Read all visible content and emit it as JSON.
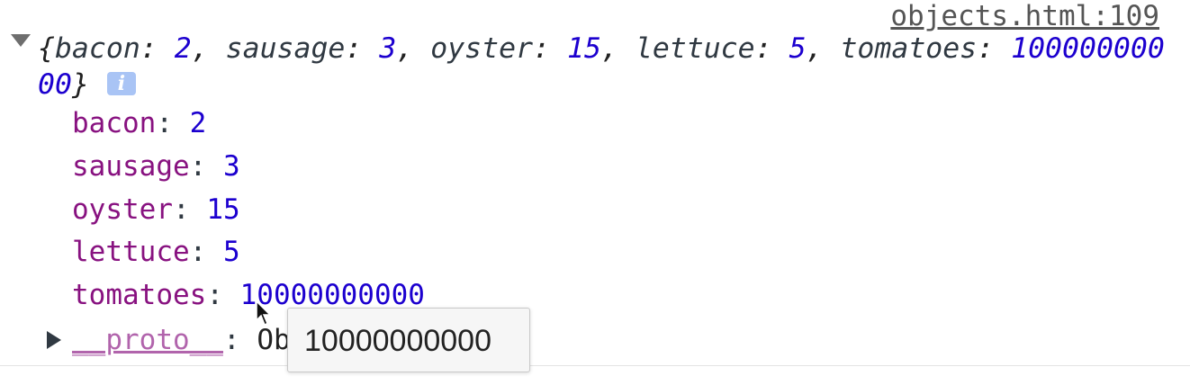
{
  "console": {
    "source_link": "objects.html:109",
    "summary": {
      "open_brace": "{",
      "close_brace": "}",
      "entries": [
        {
          "key": "bacon",
          "value": "2"
        },
        {
          "key": "sausage",
          "value": "3"
        },
        {
          "key": "oyster",
          "value": "15"
        },
        {
          "key": "lettuce",
          "value": "5"
        },
        {
          "key": "tomatoes",
          "value": "10000000000"
        }
      ],
      "info_badge": "i"
    },
    "properties": [
      {
        "key": "bacon",
        "value": "2"
      },
      {
        "key": "sausage",
        "value": "3"
      },
      {
        "key": "oyster",
        "value": "15"
      },
      {
        "key": "lettuce",
        "value": "5"
      },
      {
        "key": "tomatoes",
        "value": "10000000000"
      }
    ],
    "proto": {
      "key": "__proto__",
      "value": "Object"
    },
    "tooltip": "10000000000",
    "colors": {
      "key_purple": "#881280",
      "number_blue": "#1c00cf",
      "badge_blue": "#a9c4f5"
    },
    "icons": [
      "expanded-triangle-icon",
      "collapsed-triangle-icon",
      "info-icon",
      "mouse-pointer-icon"
    ]
  }
}
